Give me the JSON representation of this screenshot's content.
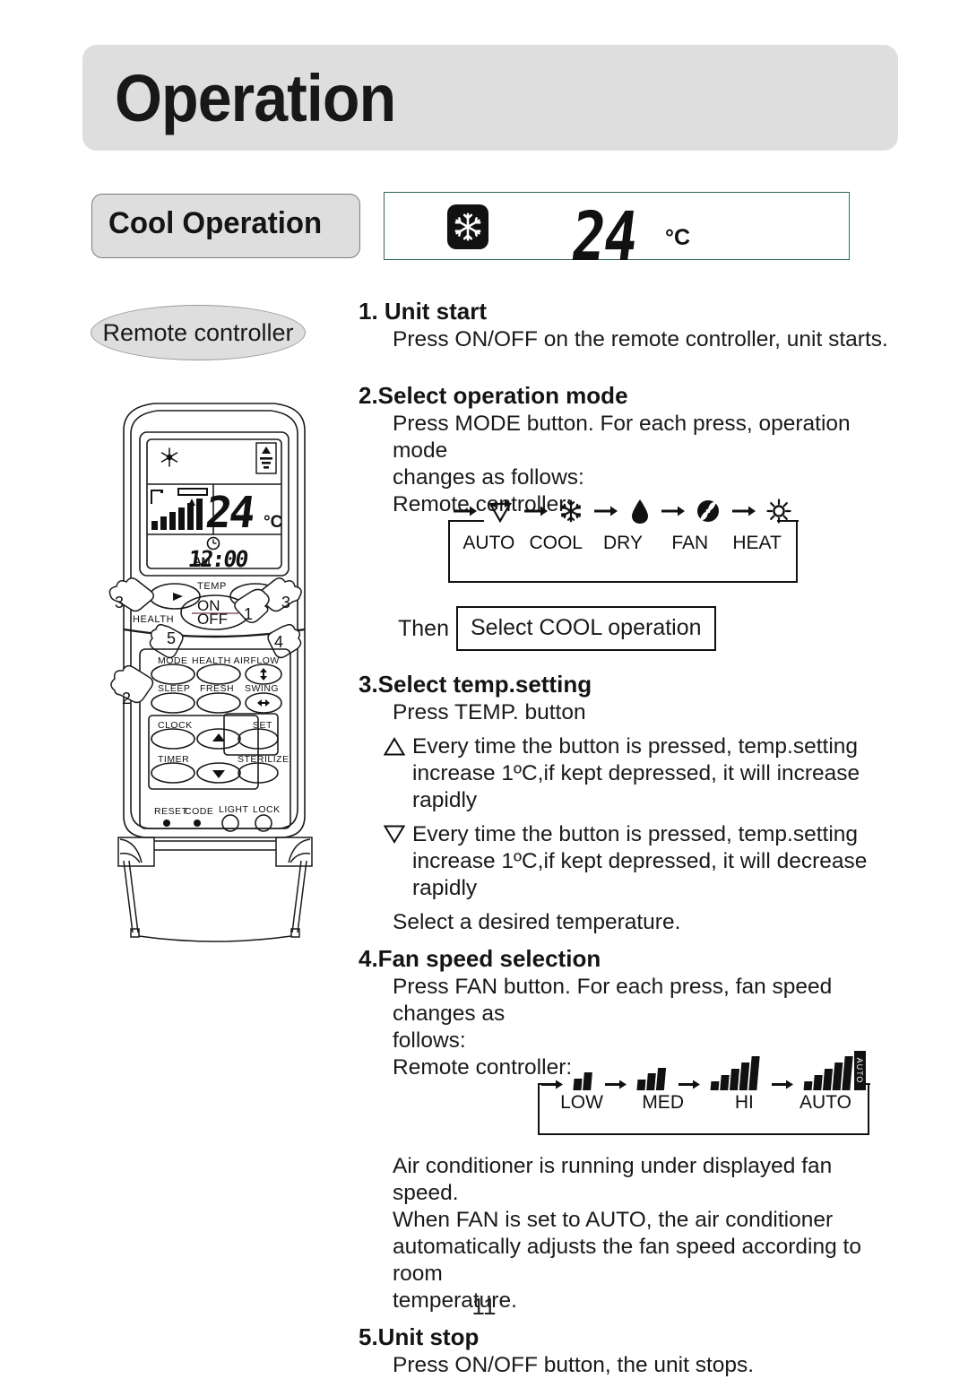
{
  "page": {
    "title": "Operation",
    "number": "11"
  },
  "section": {
    "title": "Cool Operation"
  },
  "display": {
    "mode_icon": "snowflake-icon",
    "temperature": "24",
    "unit": "°C",
    "border_color": "#2f6b4f"
  },
  "remote_label": "Remote controller",
  "remote": {
    "lcd": {
      "mode_icon": "snowflake-icon",
      "signal_icon": "signal-icon",
      "temperature": "24",
      "unit": "°C",
      "clock_icon": "clock-icon",
      "meridiem": "AM",
      "time": "12:00"
    },
    "labels": {
      "temp": "TEMP",
      "health": "HEALTH",
      "on": "ON",
      "off": "OFF",
      "mode": "MODE",
      "health_airflow": "HEALTH AIRFLOW",
      "sleep": "SLEEP",
      "fresh": "FRESH",
      "swing": "SWING",
      "clock": "CLOCK",
      "set": "SET",
      "timer": "TIMER",
      "sterilize": "STERILIZE",
      "reset": "RESET",
      "code": "CODE",
      "light": "LIGHT",
      "lock": "LOCK"
    },
    "callouts": [
      "1",
      "2",
      "3",
      "3",
      "4",
      "5"
    ]
  },
  "steps": [
    {
      "heading": "1. Unit start",
      "body": "Press ON/OFF on the remote controller, unit starts."
    },
    {
      "heading": "2.Select operation mode",
      "body_line1": "Press MODE button. For each press, operation mode",
      "body_line2": "changes as follows:",
      "body_line3": "Remote controller:",
      "then_label": "Then",
      "then_box": "Select COOL operation"
    },
    {
      "heading": "3.Select temp.setting",
      "body": "Press TEMP. button",
      "bullet_up_icon": "triangle-up-icon",
      "bullet_up": "Every time the button is pressed, temp.setting increase 1ºC,if kept depressed, it will increase rapidly",
      "bullet_down_icon": "triangle-down-icon",
      "bullet_down": "Every time the button is pressed, temp.setting increase 1ºC,if kept depressed, it will decrease rapidly",
      "closing": "Select a desired temperature."
    },
    {
      "heading": "4.Fan speed selection",
      "body_line1": "Press FAN button. For each press, fan speed changes as",
      "body_line2": "follows:",
      "body_line3": "Remote controller:",
      "note_line1": "Air conditioner is running under displayed fan speed.",
      "note_line2": "When FAN is set to AUTO, the air conditioner",
      "note_line3": "automatically adjusts the fan speed according to room",
      "note_line4": "temperature."
    },
    {
      "heading": "5.Unit stop",
      "body": "Press ON/OFF button, the unit stops."
    }
  ],
  "mode_flow": {
    "items": [
      {
        "label": "AUTO",
        "icon": "auto-triangle-icon"
      },
      {
        "label": "COOL",
        "icon": "snowflake-icon"
      },
      {
        "label": "DRY",
        "icon": "water-drop-icon"
      },
      {
        "label": "FAN",
        "icon": "fan-blade-icon"
      },
      {
        "label": "HEAT",
        "icon": "sun-icon"
      }
    ]
  },
  "fan_flow": {
    "items": [
      {
        "label": "LOW",
        "bars": 2,
        "auto_tag": ""
      },
      {
        "label": "MED",
        "bars": 3,
        "auto_tag": ""
      },
      {
        "label": "HI",
        "bars": 5,
        "auto_tag": ""
      },
      {
        "label": "AUTO",
        "bars": 5,
        "auto_tag": "AUTO"
      }
    ]
  }
}
